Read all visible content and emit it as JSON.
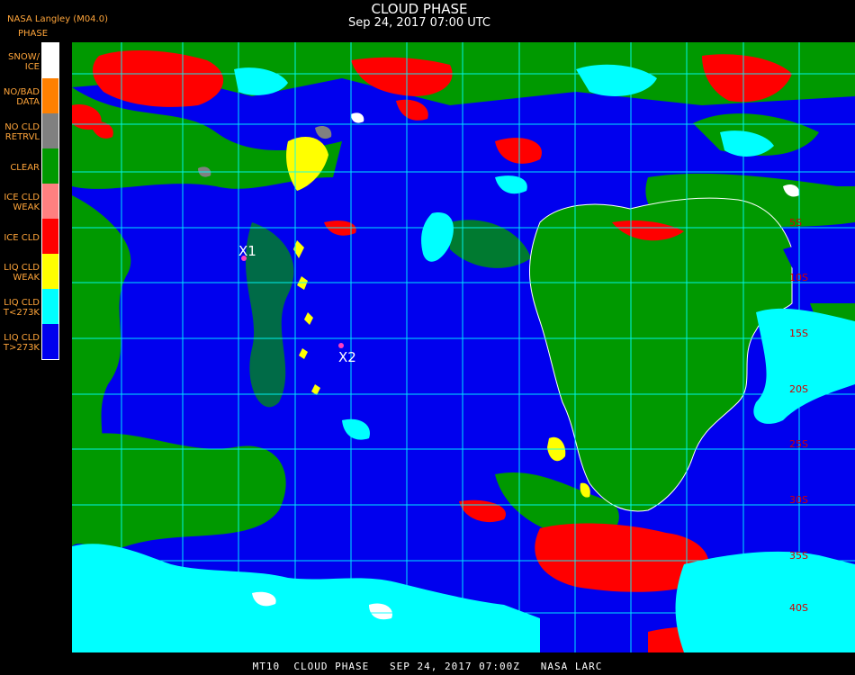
{
  "header": {
    "org": "NASA Langley (M04.0)",
    "title": "CLOUD PHASE",
    "subtitle": "Sep 24, 2017 07:00 UTC"
  },
  "legend": {
    "title": "PHASE",
    "items": [
      {
        "label": "SNOW/\nICE",
        "color": "#ffffff"
      },
      {
        "label": "NO/BAD\nDATA",
        "color": "#ff8000"
      },
      {
        "label": "NO CLD\nRETRVL",
        "color": "#808080"
      },
      {
        "label": "CLEAR",
        "color": "#009900"
      },
      {
        "label": "ICE CLD\nWEAK",
        "color": "#ff8080"
      },
      {
        "label": "ICE CLD",
        "color": "#ff0000"
      },
      {
        "label": "LIQ CLD\nWEAK",
        "color": "#ffff00"
      },
      {
        "label": "LIQ CLD\nT<273K",
        "color": "#00ffff"
      },
      {
        "label": "LIQ CLD\nT>273K",
        "color": "#0000ee"
      }
    ]
  },
  "map": {
    "grid_color": "#00ffff",
    "latitude_labels": [
      "5S",
      "10S",
      "15S",
      "20S",
      "25S",
      "30S",
      "35S",
      "40S"
    ],
    "markers": [
      {
        "label": "X1"
      },
      {
        "label": "X2"
      }
    ]
  },
  "footer": {
    "text": "MT10  CLOUD PHASE   SEP 24, 2017 07:00Z   NASA LARC"
  }
}
